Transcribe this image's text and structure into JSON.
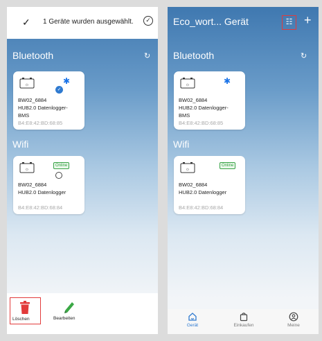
{
  "left": {
    "selection_text": "1 Geräte wurden ausgewählt.",
    "bluetooth_title": "Bluetooth",
    "wifi_title": "Wifi",
    "bt_card": {
      "id": "BW02_6884",
      "line2": "HUB2.0 Datenlogger-",
      "line3": "BMS",
      "mac": "B4:E8:42:BD:68:85"
    },
    "wifi_card": {
      "id": "BW02_6884",
      "line2": "HUB2.0 Datenlogger",
      "badge": "Online",
      "mac": "B4:E8:42:BD:68:84"
    },
    "delete_label": "Löschen",
    "edit_label": "Bearbeiten"
  },
  "right": {
    "title": "Eco_wort... Gerät",
    "bluetooth_title": "Bluetooth",
    "wifi_title": "Wifi",
    "bt_card": {
      "id": "BW02_6884",
      "line2": "HUB2.0 Datenlogger-",
      "line3": "BMS",
      "mac": "B4:E8:42:BD:68:85"
    },
    "wifi_card": {
      "id": "BW02_6884",
      "line2": "HUB2.0 Datenlogger",
      "badge": "Online",
      "mac": "B4:E8:42:BD:68:84"
    },
    "tabs": [
      {
        "label": "Gerät",
        "icon": "home-icon",
        "active": true
      },
      {
        "label": "Einkaufen",
        "icon": "shopping-bag-icon",
        "active": false
      },
      {
        "label": "Meine",
        "icon": "profile-icon",
        "active": false
      }
    ]
  },
  "colors": {
    "accent": "#2f7ad0",
    "highlight": "#e23b3b",
    "online": "#35a244",
    "edit": "#3aa845"
  }
}
